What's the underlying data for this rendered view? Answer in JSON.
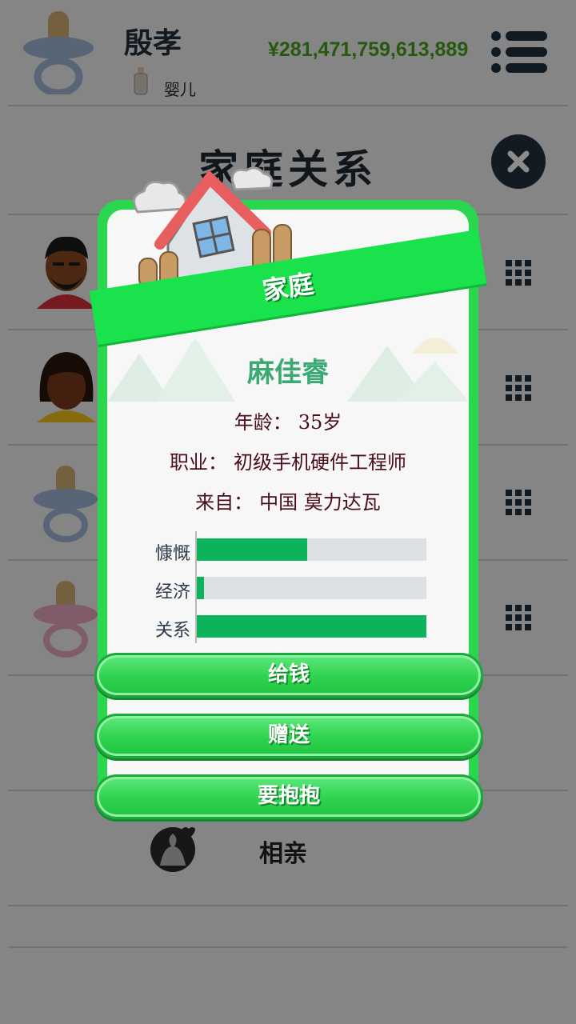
{
  "header": {
    "player_name": "殷孝",
    "life_stage": "婴儿",
    "money": "¥281,471,759,613,889"
  },
  "page": {
    "title": "家庭关系",
    "blind_date_label": "相亲"
  },
  "modal": {
    "banner_title": "家庭",
    "person_name": "麻佳睿",
    "age_label": "年龄：",
    "age_value": "35岁",
    "job_label": "职业：",
    "job_value": "初级手机硬件工程师",
    "from_label": "来自：",
    "from_value": "中国 莫力达瓦",
    "stats": [
      {
        "label": "慷慨",
        "value": 0.48
      },
      {
        "label": "经济",
        "value": 0.03
      },
      {
        "label": "关系",
        "value": 1.0
      }
    ],
    "buttons": [
      "给钱",
      "赠送",
      "要抱抱"
    ]
  },
  "colors": {
    "accent_green": "#2bd64f",
    "bar_fill": "#0db35a",
    "money_green": "#46a018",
    "name_teal": "#3aaa72"
  }
}
